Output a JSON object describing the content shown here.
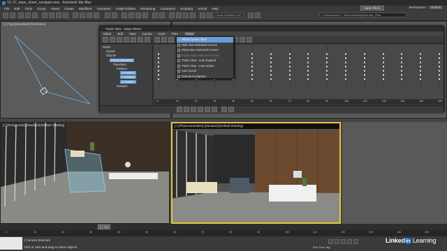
{
  "app": {
    "title": "10_07_dope_sheet_navigate.max - Autodesk 3ds Max",
    "sign_in": "Aaron Rizzo",
    "workspaces_label": "Workspaces:",
    "workspace_value": "Default"
  },
  "menubar": {
    "items": [
      "File",
      "Edit",
      "Tools",
      "Group",
      "Views",
      "Create",
      "Modifiers",
      "Animation",
      "Graph Editors",
      "Rendering",
      "Customize",
      "Scripting",
      "Arnold",
      "Help"
    ]
  },
  "toolbar": {
    "selection_set": "Create Selection Set",
    "path": "C:\\Users\\Aaron T. Rizzo\\Desktop\\Exercise_Files"
  },
  "viewports": {
    "top_label": "[+] [Top] [Standard] [Wireframe]",
    "persp_label": "[+] [Perspective] [Standard] [Default Shading]",
    "physcam_label": "[+] [PhysCamera001] [Standard] [Default Shading]"
  },
  "dopesheet": {
    "title": "Track View - Dope Sheet",
    "menu": [
      "Editor",
      "Edit",
      "View",
      "Curves",
      "Keys",
      "Time",
      "Show"
    ],
    "name_field": "Track View - Dope Sheet",
    "tree": [
      {
        "label": "World",
        "level": 0,
        "selected": false
      },
      {
        "label": "Sound",
        "level": 1,
        "selected": false
      },
      {
        "label": "Objects",
        "level": 1,
        "selected": false
      },
      {
        "label": "PhysCamera001",
        "level": 2,
        "selected": true
      },
      {
        "label": "Transform",
        "level": 3,
        "selected": false
      },
      {
        "label": "Position",
        "level": 4,
        "selected": false
      },
      {
        "label": "X Position",
        "level": 5,
        "selected": true
      },
      {
        "label": "Y Position",
        "level": 5,
        "selected": true
      },
      {
        "label": "Z Position",
        "level": 5,
        "selected": true
      },
      {
        "label": "Rotation",
        "level": 4,
        "selected": false
      }
    ],
    "ruler_labels": [
      "0",
      "10",
      "20",
      "30",
      "40",
      "50",
      "60",
      "70",
      "80",
      "90",
      "100",
      "110",
      "120",
      "130",
      "140",
      "150"
    ]
  },
  "show_menu": {
    "items": [
      {
        "label": "Show Curves Time",
        "highlighted": true,
        "disabled": false
      },
      {
        "label": "Hide Non-Selected Curves",
        "highlighted": false,
        "disabled": false
      },
      {
        "label": "Show Non-Selected Curves",
        "highlighted": false,
        "disabled": false
      },
      {
        "label": "Frame Non-Selected Curves",
        "highlighted": false,
        "disabled": true
      },
      {
        "label": "Track View - Auto Expand",
        "highlighted": false,
        "disabled": false
      },
      {
        "label": "Track View - Auto Select",
        "highlighted": false,
        "disabled": false
      },
      {
        "label": "Auto Scroll",
        "highlighted": false,
        "disabled": false
      },
      {
        "label": "Manual Navigation",
        "highlighted": false,
        "disabled": false
      }
    ]
  },
  "timeline": {
    "frame": "0 / 150",
    "ticks": [
      "0",
      "10",
      "20",
      "30",
      "40",
      "50",
      "60",
      "70",
      "80",
      "90",
      "100",
      "110",
      "120",
      "130",
      "140",
      "150"
    ]
  },
  "status": {
    "line1": "1 Camera Selected",
    "line2": "Click or click-and-drag to select objects",
    "add_time_tag": "Add Time Tag",
    "watermark_brand": "Linked",
    "watermark_in": "in",
    "watermark_suffix": "Learning"
  },
  "colors": {
    "selection_blue": "#6aa0d8",
    "viewport_active_border": "#e8c43a",
    "camera_line": "#6fb6e8"
  }
}
